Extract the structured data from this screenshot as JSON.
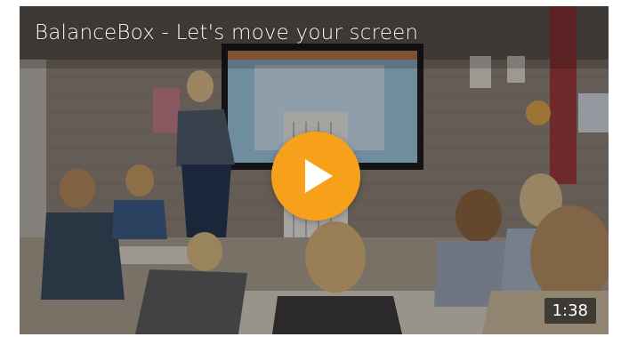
{
  "video": {
    "title": "BalanceBox - Let's move your screen",
    "duration": "1:38",
    "accent_color": "#f7a11a",
    "play_icon": "play-icon"
  }
}
